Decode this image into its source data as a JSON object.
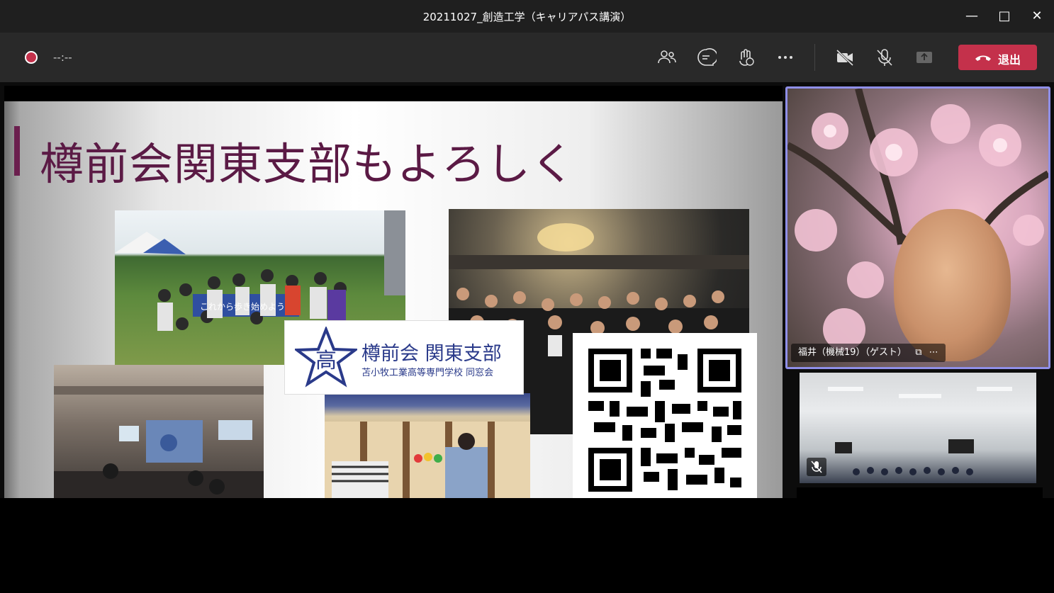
{
  "window": {
    "title": "20211027_創造工学（キャリアパス講演）",
    "minimize_icon": "minimize-icon",
    "maximize_icon": "maximize-icon",
    "close_icon": "close-icon"
  },
  "toolbar": {
    "timer": "--:--",
    "icons": [
      "people-icon",
      "chat-icon",
      "raise-hand-icon",
      "more-icon",
      "camera-off-icon",
      "mic-off-icon",
      "share-icon"
    ],
    "leave_label": "退出",
    "leave_color": "#c4314b"
  },
  "slide": {
    "heading": "樽前会関東支部もよろしく",
    "logo_title": "樽前会 関東支部",
    "logo_subtitle": "苫小牧工業高等専門学校 同窓会",
    "logo_emblem_char": "高",
    "banner_text": "これから歩き始めよう",
    "accent_color": "#6b1f4e"
  },
  "participants": [
    {
      "name": "福井（機械19）（ゲスト）",
      "active": true
    },
    {
      "name": "",
      "muted": true
    }
  ]
}
